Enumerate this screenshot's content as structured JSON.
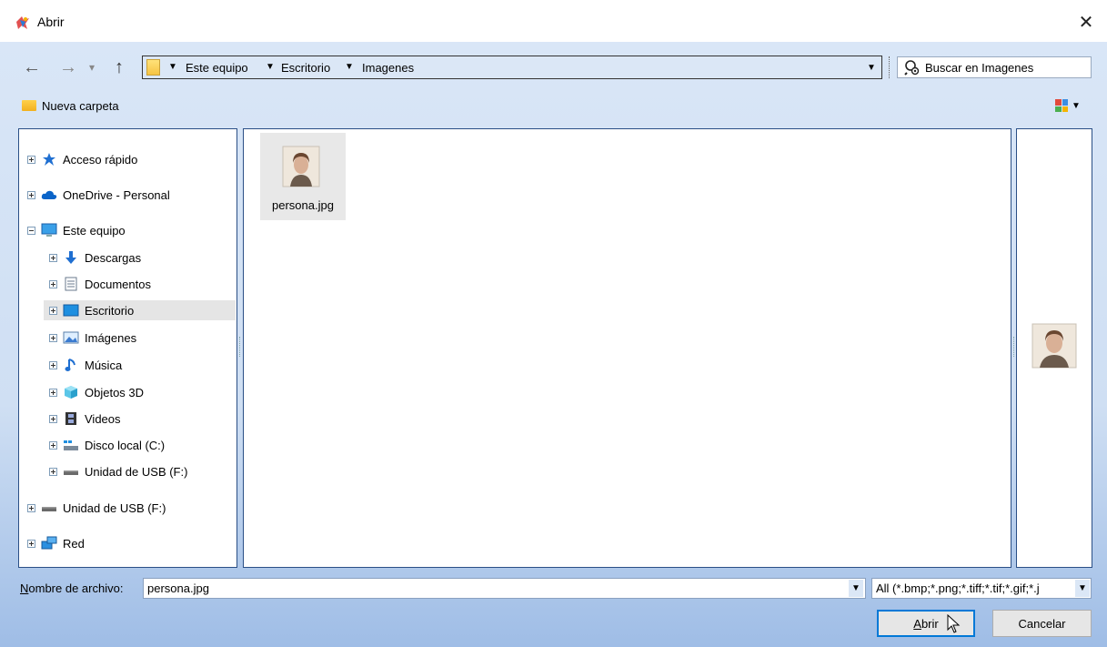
{
  "window": {
    "title": "Abrir",
    "close_glyph": "✕"
  },
  "nav": {
    "back": "←",
    "forward": "→",
    "recent": "▾",
    "up": "↑"
  },
  "address": {
    "crumbs": [
      "Este equipo",
      "Escritorio",
      "Imagenes"
    ],
    "arrow": "▼",
    "dropdown": "▼"
  },
  "search": {
    "placeholder": "Buscar en Imagenes"
  },
  "toolbar": {
    "new_folder": "Nueva carpeta",
    "view_dropdown": "▼"
  },
  "tree": [
    {
      "label": "Acceso rápido",
      "icon": "star-icon",
      "indent": 0,
      "expander": "plus"
    },
    {
      "label": "OneDrive - Personal",
      "icon": "cloud-icon",
      "indent": 0,
      "expander": "plus"
    },
    {
      "label": "Este equipo",
      "icon": "computer-icon",
      "indent": 0,
      "expander": "minus"
    },
    {
      "label": "Descargas",
      "icon": "download-icon",
      "indent": 1,
      "expander": "plus"
    },
    {
      "label": "Documentos",
      "icon": "document-icon",
      "indent": 1,
      "expander": "plus"
    },
    {
      "label": "Escritorio",
      "icon": "desktop-icon",
      "indent": 1,
      "expander": "plus",
      "selected": true
    },
    {
      "label": "Imágenes",
      "icon": "pictures-icon",
      "indent": 1,
      "expander": "plus"
    },
    {
      "label": "Música",
      "icon": "music-icon",
      "indent": 1,
      "expander": "plus"
    },
    {
      "label": "Objetos 3D",
      "icon": "cube-icon",
      "indent": 1,
      "expander": "plus"
    },
    {
      "label": "Videos",
      "icon": "film-icon",
      "indent": 1,
      "expander": "plus"
    },
    {
      "label": "Disco local (C:)",
      "icon": "drive-icon",
      "indent": 1,
      "expander": "plus"
    },
    {
      "label": "Unidad de USB (F:)",
      "icon": "usb-drive-icon",
      "indent": 1,
      "expander": "plus"
    },
    {
      "label": "Unidad de USB (F:)",
      "icon": "usb-drive-icon",
      "indent": 0,
      "expander": "plus"
    },
    {
      "label": "Red",
      "icon": "network-icon",
      "indent": 0,
      "expander": "plus"
    }
  ],
  "files": [
    {
      "name": "persona.jpg",
      "icon": "portrait-thumbnail-icon"
    }
  ],
  "bottom": {
    "filename_label_first": "N",
    "filename_label_rest": "ombre de archivo:",
    "filename_value": "persona.jpg",
    "filetype_value": "All (*.bmp;*.png;*.tiff;*.tif;*.gif;*.j",
    "dropdown": "▼",
    "open_first": "A",
    "open_rest": "brir",
    "cancel": "Cancelar"
  }
}
